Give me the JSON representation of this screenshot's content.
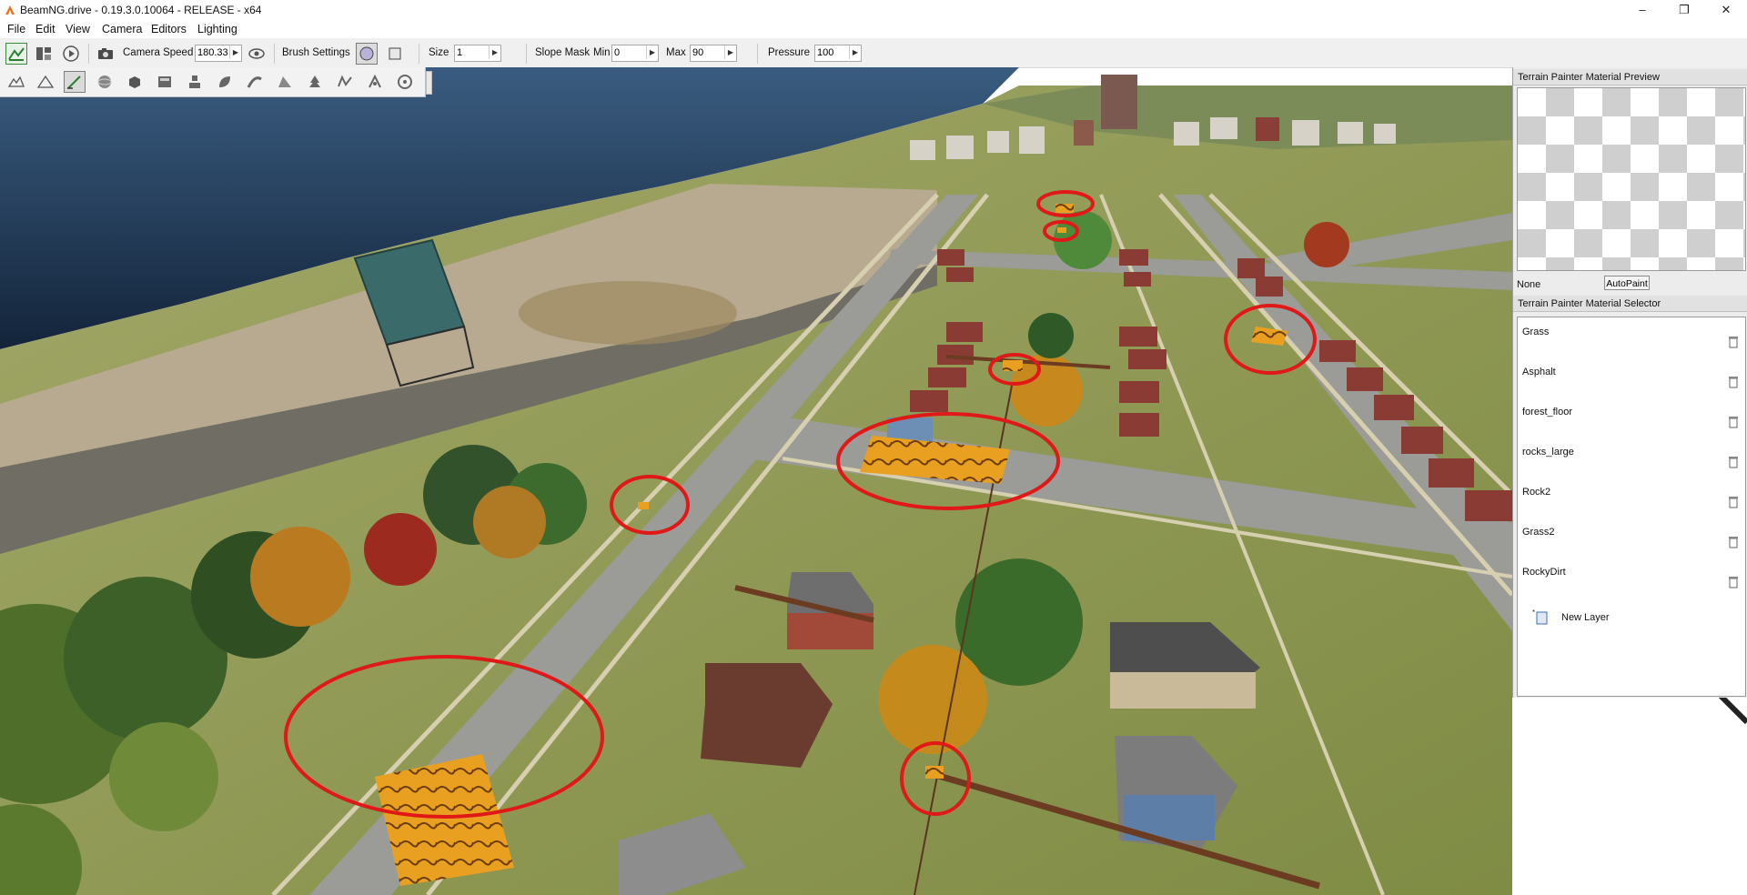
{
  "window": {
    "title": "BeamNG.drive - 0.19.3.0.10064 - RELEASE - x64",
    "controls": {
      "minimize": "–",
      "maximize": "❐",
      "close": "✕"
    }
  },
  "menu": [
    "File",
    "Edit",
    "View",
    "Camera",
    "Editors",
    "Lighting"
  ],
  "toolbar": {
    "camera_speed_label": "Camera Speed",
    "camera_speed_value": "180.33",
    "brush_settings_label": "Brush Settings",
    "size_label": "Size",
    "size_value": "1",
    "slope_mask_label": "Slope Mask",
    "min_label": "Min",
    "min_value": "0",
    "max_label": "Max",
    "max_value": "90",
    "pressure_label": "Pressure",
    "pressure_value": "100"
  },
  "editor_tools": [
    "select-terrain-tool",
    "raise-height-tool",
    "paint-material-tool",
    "sphere-tool",
    "object-tool",
    "datablock-tool",
    "road-tool",
    "river-tool",
    "mesh-road-tool",
    "decal-tool",
    "forest-tool",
    "navmesh-tool",
    "particle-tool",
    "wheel-tool"
  ],
  "preview_panel": {
    "title": "Terrain Painter Material Preview",
    "current_material": "None",
    "autopaint_label": "AutoPaint"
  },
  "selector_panel": {
    "title": "Terrain Painter Material Selector",
    "materials": [
      "Grass",
      "Asphalt",
      "forest_floor",
      "rocks_large",
      "Rock2",
      "Grass2",
      "RockyDirt"
    ],
    "new_layer_label": "New Layer"
  },
  "colors": {
    "water": "#1f3550",
    "grass": "#8e9a4e",
    "road": "#9e9e9a",
    "highlight_circle": "#e01818",
    "painted_patch": "#e9a021"
  }
}
